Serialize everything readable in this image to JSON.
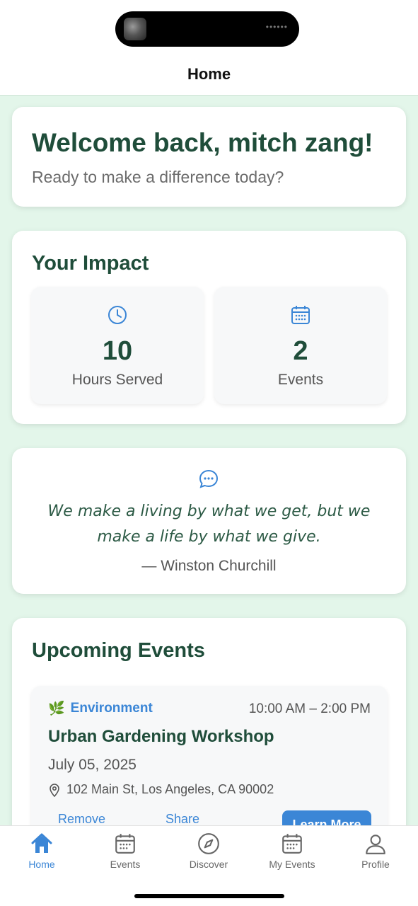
{
  "header": {
    "title": "Home"
  },
  "welcome": {
    "heading": "Welcome back, mitch zang!",
    "subtitle": "Ready to make a difference today?"
  },
  "impact": {
    "title": "Your Impact",
    "stats": [
      {
        "icon": "clock-icon",
        "value": "10",
        "label": "Hours Served"
      },
      {
        "icon": "calendar-icon",
        "value": "2",
        "label": "Events"
      }
    ]
  },
  "quote": {
    "icon": "chat-bubble-icon",
    "text": "We make a living by what we get, but we make a life by what we give.",
    "author": "— Winston Churchill"
  },
  "upcoming": {
    "title": "Upcoming Events",
    "events": [
      {
        "category": "Environment",
        "category_icon": "leaf-icon",
        "time": "10:00 AM – 2:00 PM",
        "title": "Urban Gardening Workshop",
        "date": "July 05, 2025",
        "location": "102 Main St, Los Angeles, CA 90002",
        "actions": {
          "remove": "Remove",
          "share": "Share",
          "learn_more": "Learn More"
        }
      }
    ]
  },
  "tabbar": {
    "active": "Home",
    "tabs": [
      {
        "label": "Home",
        "icon": "home-icon"
      },
      {
        "label": "Events",
        "icon": "calendar-icon"
      },
      {
        "label": "Discover",
        "icon": "compass-icon"
      },
      {
        "label": "My Events",
        "icon": "calendar-icon"
      },
      {
        "label": "Profile",
        "icon": "person-icon"
      }
    ]
  },
  "colors": {
    "accent": "#3b86d6",
    "heading_green": "#1f4d3a",
    "background": "#e3f6ea"
  }
}
